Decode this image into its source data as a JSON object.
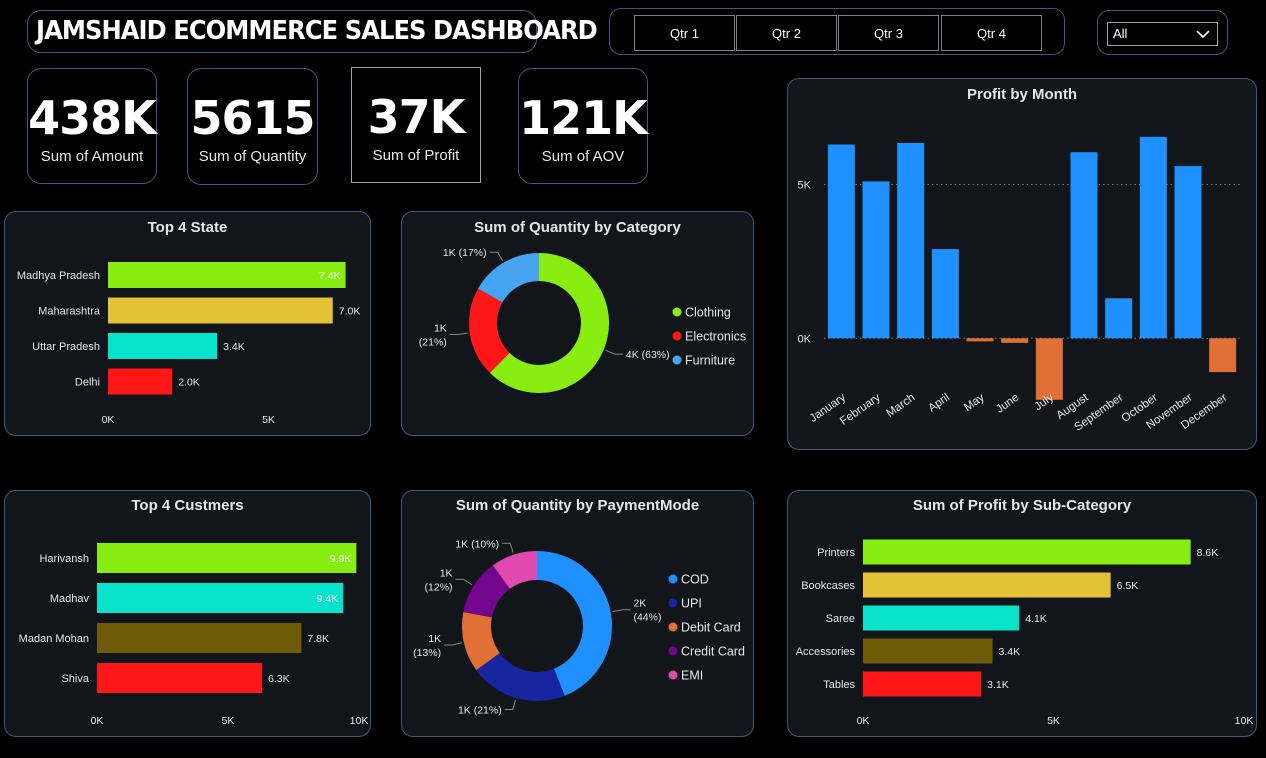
{
  "header": {
    "title": "JAMSHAID ECOMMERCE SALES DASHBOARD"
  },
  "quarters": [
    "Qtr 1",
    "Qtr 2",
    "Qtr 3",
    "Qtr 4"
  ],
  "filter": {
    "selected": "All"
  },
  "kpis": [
    {
      "value": "438K",
      "label": "Sum of Amount"
    },
    {
      "value": "5615",
      "label": "Sum of Quantity"
    },
    {
      "value": "37K",
      "label": "Sum of Profit"
    },
    {
      "value": "121K",
      "label": "Sum of AOV"
    }
  ],
  "colors": {
    "lime": "#88ee11",
    "gold": "#e3c236",
    "teal": "#08e4cc",
    "red": "#ff1616",
    "olive": "#6d5b05",
    "blue": "#1e90ff",
    "navy": "#1726a0",
    "orange": "#e07035",
    "purple": "#73068c",
    "pink": "#e04aae",
    "sky": "#46a4f0"
  },
  "chart_data": [
    {
      "id": "top_state",
      "type": "bar",
      "orientation": "horizontal",
      "title": "Top 4 State",
      "categories": [
        "Madhya Pradesh",
        "Maharashtra",
        "Uttar Pradesh",
        "Delhi"
      ],
      "values": [
        7400,
        7000,
        3400,
        2000
      ],
      "labels": [
        "7.4K",
        "7.0K",
        "3.4K",
        "2.0K"
      ],
      "colors": [
        "#88ee11",
        "#e3c236",
        "#08e4cc",
        "#ff1616"
      ],
      "xlim": [
        0,
        7600
      ],
      "ticks": [
        0,
        5000
      ],
      "tick_labels": [
        "0K",
        "5K"
      ]
    },
    {
      "id": "qty_category",
      "type": "pie",
      "donut": true,
      "title": "Sum of Quantity by Category",
      "categories": [
        "Clothing",
        "Electronics",
        "Furniture"
      ],
      "values": [
        63,
        21,
        17
      ],
      "labels": [
        "4K (63%)",
        "1K (21%)",
        "1K (17%)"
      ],
      "colors": [
        "#88ee11",
        "#ff1616",
        "#46a4f0"
      ],
      "legend": "right"
    },
    {
      "id": "profit_month",
      "type": "bar",
      "title": "Profit by Month",
      "categories": [
        "January",
        "February",
        "March",
        "April",
        "May",
        "June",
        "July",
        "August",
        "September",
        "October",
        "November",
        "December"
      ],
      "values": [
        6300,
        5100,
        6350,
        2900,
        -100,
        -150,
        -2000,
        6050,
        1300,
        6550,
        5600,
        -1100
      ],
      "ylim": [
        -2300,
        7000
      ],
      "ticks": [
        0,
        5000
      ],
      "tick_labels": [
        "0K",
        "5K"
      ],
      "grid": true,
      "colors": {
        "positive": "#1e90ff",
        "negative": "#e07035"
      }
    },
    {
      "id": "top_customers",
      "type": "bar",
      "orientation": "horizontal",
      "title": "Top 4 Custmers",
      "categories": [
        "Harivansh",
        "Madhav",
        "Madan Mohan",
        "Shiva"
      ],
      "values": [
        9900,
        9400,
        7800,
        6300
      ],
      "labels": [
        "9.9K",
        "9.4K",
        "7.8K",
        "6.3K"
      ],
      "colors": [
        "#88ee11",
        "#08e4cc",
        "#6d5b05",
        "#ff1616"
      ],
      "xlim": [
        0,
        10000
      ],
      "ticks": [
        0,
        5000,
        10000
      ],
      "tick_labels": [
        "0K",
        "5K",
        "10K"
      ]
    },
    {
      "id": "qty_payment",
      "type": "pie",
      "donut": true,
      "title": "Sum of Quantity by PaymentMode",
      "categories": [
        "COD",
        "UPI",
        "Debit Card",
        "Credit Card",
        "EMI"
      ],
      "values": [
        44,
        21,
        13,
        12,
        10
      ],
      "labels": [
        "2K (44%)",
        "1K (21%)",
        "1K (13%)",
        "1K (12%)",
        "1K (10%)"
      ],
      "colors": [
        "#1e90ff",
        "#1726a0",
        "#e07035",
        "#73068c",
        "#e04aae"
      ],
      "legend": "right"
    },
    {
      "id": "profit_subcat",
      "type": "bar",
      "orientation": "horizontal",
      "title": "Sum of Profit by Sub-Category",
      "categories": [
        "Printers",
        "Bookcases",
        "Saree",
        "Accessories",
        "Tables"
      ],
      "values": [
        8600,
        6500,
        4100,
        3400,
        3100
      ],
      "labels": [
        "8.6K",
        "6.5K",
        "4.1K",
        "3.4K",
        "3.1K"
      ],
      "colors": [
        "#88ee11",
        "#e3c236",
        "#08e4cc",
        "#6d5b05",
        "#ff1616"
      ],
      "xlim": [
        0,
        10000
      ],
      "ticks": [
        0,
        5000,
        10000
      ],
      "tick_labels": [
        "0K",
        "5K",
        "10K"
      ]
    }
  ]
}
